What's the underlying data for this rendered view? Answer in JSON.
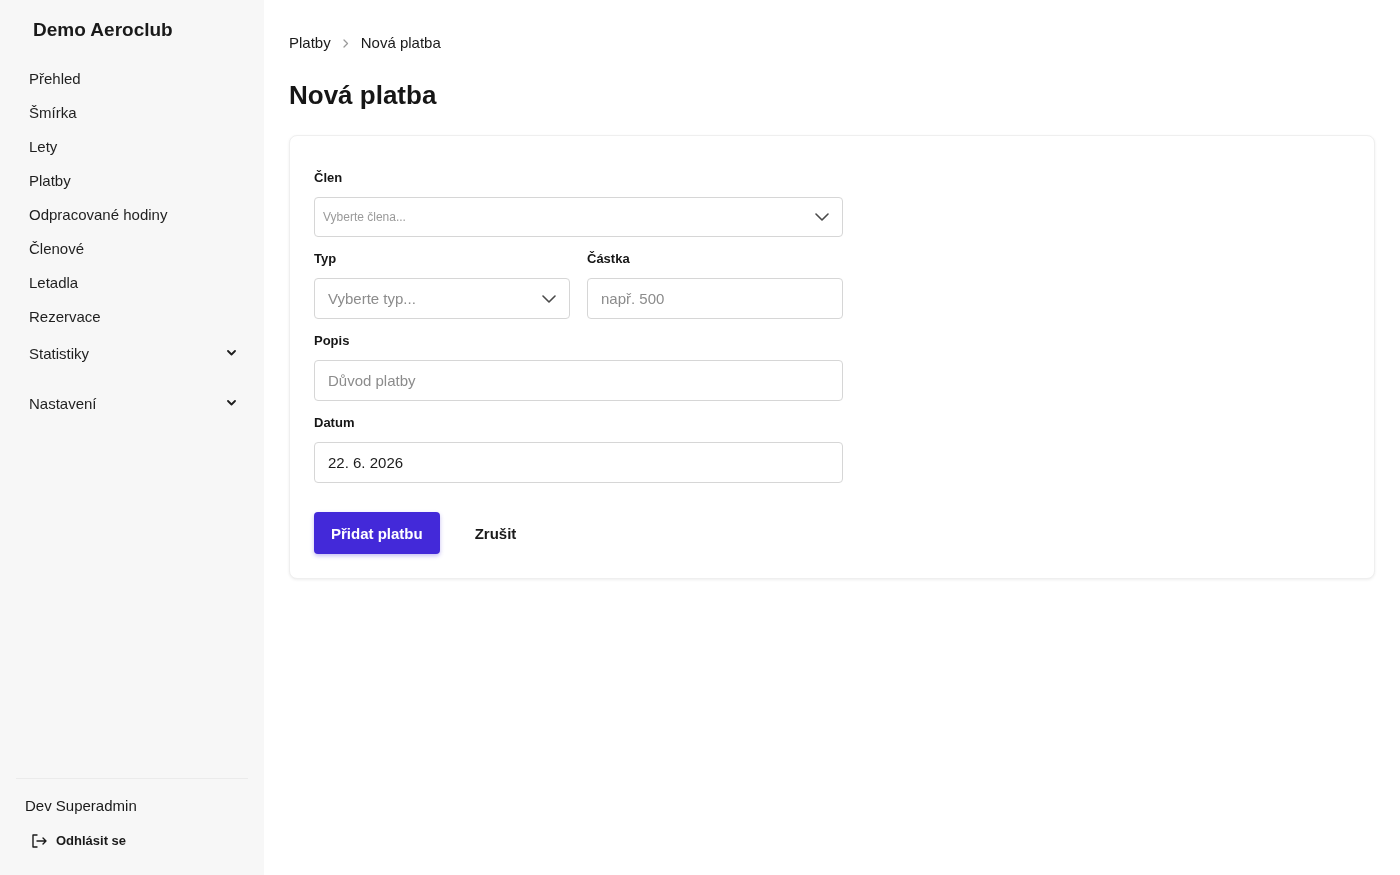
{
  "sidebar": {
    "brand": "Demo Aeroclub",
    "items": [
      {
        "label": "Přehled",
        "kind": "link",
        "selected": false
      },
      {
        "label": "Šmírka",
        "kind": "link",
        "selected": false
      },
      {
        "label": "Lety",
        "kind": "link",
        "selected": false
      },
      {
        "label": "Platby",
        "kind": "link",
        "selected": false
      },
      {
        "label": "Odpracované hodiny",
        "kind": "link",
        "selected": false
      },
      {
        "label": "Členové",
        "kind": "link",
        "selected": false
      },
      {
        "label": "Letadla",
        "kind": "link",
        "selected": false
      },
      {
        "label": "Rezervace",
        "kind": "link",
        "selected": false
      },
      {
        "label": "Statistiky",
        "kind": "group",
        "selected": false,
        "expanded": false
      },
      {
        "label": "Nastavení",
        "kind": "group",
        "selected": false,
        "expanded": false
      }
    ],
    "user": "Dev Superadmin",
    "logout": "Odhlásit se"
  },
  "breadcrumb": [
    "Platby",
    "Nová platba"
  ],
  "title": "Nová platba",
  "form": {
    "rows": [
      [
        {
          "label": "Člen",
          "kind": "combobox",
          "placeholder": "Vyberte člena..."
        }
      ],
      [
        {
          "label": "Typ",
          "kind": "select",
          "placeholder": "Vyberte typ..."
        },
        {
          "label": "Částka",
          "kind": "text",
          "placeholder": "např. 500"
        }
      ],
      [
        {
          "label": "Popis",
          "kind": "text",
          "placeholder": "Důvod platby"
        }
      ],
      [
        {
          "label": "Datum",
          "kind": "date",
          "value": "22. 6. 2026"
        }
      ]
    ],
    "buttons": [
      {
        "label": "Přidat platbu",
        "kind": "primary"
      },
      {
        "label": "Zrušit",
        "kind": "secondary"
      }
    ]
  }
}
